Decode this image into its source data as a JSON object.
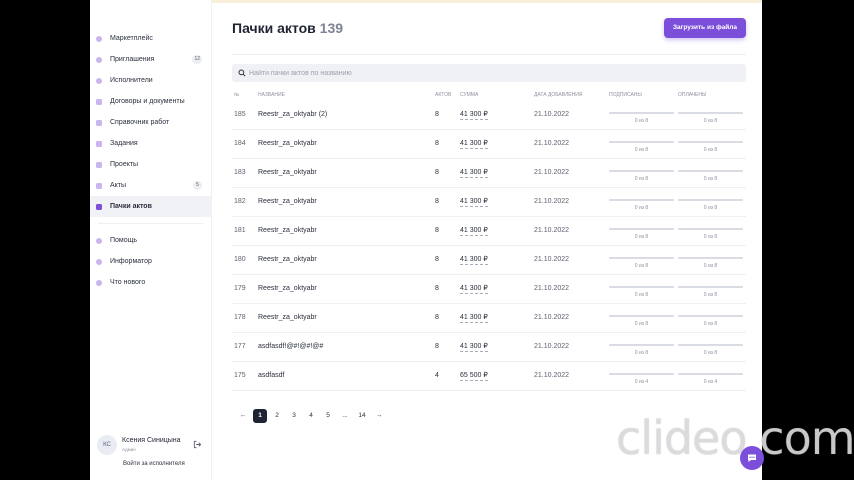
{
  "sidebar": {
    "items": [
      {
        "label": "Маркетплейс",
        "icon": "marketplace-icon"
      },
      {
        "label": "Приглашения",
        "icon": "invitations-icon",
        "badge": "12"
      },
      {
        "label": "Исполнители",
        "icon": "contractors-icon"
      },
      {
        "label": "Договоры и документы",
        "icon": "documents-icon"
      },
      {
        "label": "Справочник работ",
        "icon": "works-catalog-icon"
      },
      {
        "label": "Задания",
        "icon": "tasks-icon"
      },
      {
        "label": "Проекты",
        "icon": "projects-icon"
      },
      {
        "label": "Акты",
        "icon": "acts-icon",
        "badge": "5"
      },
      {
        "label": "Пачки актов",
        "icon": "act-batches-icon",
        "active": true
      }
    ],
    "secondary": [
      {
        "label": "Помощь",
        "icon": "help-icon"
      },
      {
        "label": "Информатор",
        "icon": "informer-icon"
      },
      {
        "label": "Что нового",
        "icon": "whats-new-icon"
      }
    ],
    "user": {
      "initials": "КС",
      "name": "Ксения Синицына",
      "role": "Админ"
    },
    "login_as": "Войти за исполнителя"
  },
  "header": {
    "title": "Пачки актов",
    "count": "139",
    "upload_label": "Загрузить из файла"
  },
  "search": {
    "placeholder": "Найти пачки актов по названию",
    "value": ""
  },
  "table": {
    "columns": [
      "№",
      "Название",
      "Актов",
      "Сумма",
      "Дата добавления",
      "Подписаны",
      "Оплачены"
    ],
    "rows": [
      {
        "id": "185",
        "name": "Reestr_za_oktyabr (2)",
        "acts": "8",
        "sum": "41 300 ₽",
        "date": "21.10.2022",
        "signed": "0 из 8",
        "paid": "0 из 8"
      },
      {
        "id": "184",
        "name": "Reestr_za_oktyabr",
        "acts": "8",
        "sum": "41 300 ₽",
        "date": "21.10.2022",
        "signed": "0 из 8",
        "paid": "0 из 8"
      },
      {
        "id": "183",
        "name": "Reestr_za_oktyabr",
        "acts": "8",
        "sum": "41 300 ₽",
        "date": "21.10.2022",
        "signed": "0 из 8",
        "paid": "0 из 8"
      },
      {
        "id": "182",
        "name": "Reestr_za_oktyabr",
        "acts": "8",
        "sum": "41 300 ₽",
        "date": "21.10.2022",
        "signed": "0 из 8",
        "paid": "0 из 8"
      },
      {
        "id": "181",
        "name": "Reestr_za_oktyabr",
        "acts": "8",
        "sum": "41 300 ₽",
        "date": "21.10.2022",
        "signed": "0 из 8",
        "paid": "0 из 8"
      },
      {
        "id": "180",
        "name": "Reestr_za_oktyabr",
        "acts": "8",
        "sum": "41 300 ₽",
        "date": "21.10.2022",
        "signed": "0 из 8",
        "paid": "0 из 8"
      },
      {
        "id": "179",
        "name": "Reestr_za_oktyabr",
        "acts": "8",
        "sum": "41 300 ₽",
        "date": "21.10.2022",
        "signed": "0 из 8",
        "paid": "0 из 8"
      },
      {
        "id": "178",
        "name": "Reestr_za_oktyabr",
        "acts": "8",
        "sum": "41 300 ₽",
        "date": "21.10.2022",
        "signed": "0 из 8",
        "paid": "0 из 8"
      },
      {
        "id": "177",
        "name": "asdfasdf!@#!@#!@#",
        "acts": "8",
        "sum": "41 300 ₽",
        "date": "21.10.2022",
        "signed": "0 из 8",
        "paid": "0 из 8"
      },
      {
        "id": "175",
        "name": "asdfasdf",
        "acts": "4",
        "sum": "65 500 ₽",
        "date": "21.10.2022",
        "signed": "0 из 4",
        "paid": "0 из 4"
      }
    ]
  },
  "pagination": {
    "prev": "←",
    "pages": [
      "1",
      "2",
      "3",
      "4",
      "5"
    ],
    "ellipsis": "...",
    "last": "14",
    "next": "→",
    "current": "1"
  },
  "watermark": "clideo.com",
  "colors": {
    "accent": "#7b4fd9",
    "active_page": "#1f2433"
  }
}
